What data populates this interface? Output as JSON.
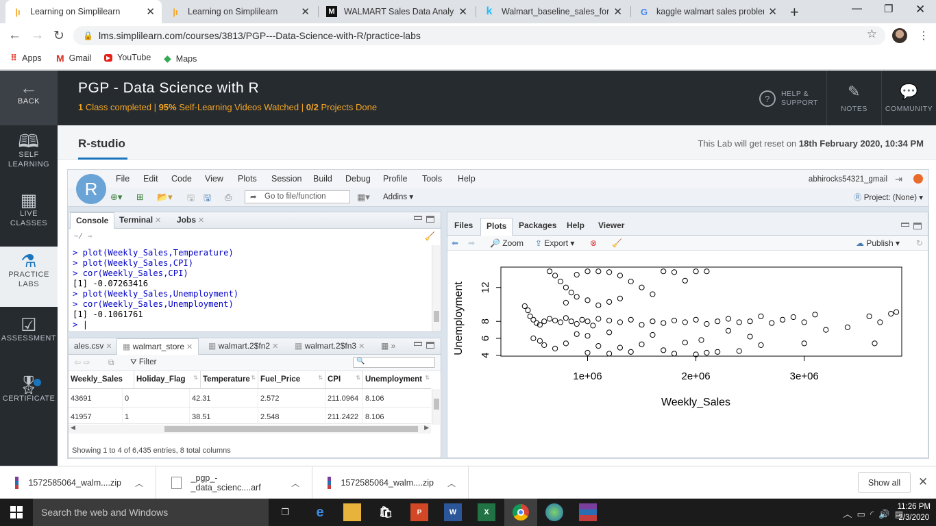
{
  "browser": {
    "tabs": [
      {
        "title": "Learning on Simplilearn",
        "active": true
      },
      {
        "title": "Learning on Simplilearn"
      },
      {
        "title": "WALMART Sales Data Analysis"
      },
      {
        "title": "Walmart_baseline_sales_foreca"
      },
      {
        "title": "kaggle walmart sales problem"
      }
    ],
    "url": "lms.simplilearn.com/courses/3813/PGP---Data-Science-with-R/practice-labs",
    "bookmarks": [
      "Apps",
      "Gmail",
      "YouTube",
      "Maps"
    ]
  },
  "rail": {
    "back": "BACK",
    "self_learning": [
      "SELF",
      "LEARNING"
    ],
    "live_classes": [
      "LIVE",
      "CLASSES"
    ],
    "practice_labs": [
      "PRACTICE",
      "LABS"
    ],
    "assessment": "ASSESSMENT",
    "certificate": "CERTIFICATE"
  },
  "header": {
    "course_title": "PGP - Data Science with R",
    "classes_completed": "1",
    "classes_label": "Class completed |",
    "videos_pct": "95%",
    "videos_label": "Self-Learning Videos Watched  |",
    "projects": "0/2",
    "projects_label": "Projects Done",
    "help": [
      "HELP &",
      "SUPPORT"
    ],
    "notes": "NOTES",
    "community": "COMMUNITY"
  },
  "lab": {
    "title": "R-studio",
    "reset_prefix": "This Lab will get reset on",
    "reset_date": "18th February 2020, 10:34 PM"
  },
  "rstudio": {
    "menu": [
      "File",
      "Edit",
      "Code",
      "View",
      "Plots",
      "Session",
      "Build",
      "Debug",
      "Profile",
      "Tools",
      "Help"
    ],
    "user": "abhirocks54321_gmail",
    "goto_placeholder": "Go to file/function",
    "addins": "Addins",
    "project": "Project: (None)",
    "console_tabs": [
      "Console",
      "Terminal",
      "Jobs"
    ],
    "cwd": "~/",
    "console_lines": [
      {
        "type": "cmd",
        "text": "> plot(Weekly_Sales,Temperature)"
      },
      {
        "type": "cmd",
        "text": "> plot(Weekly_Sales,CPI)"
      },
      {
        "type": "cmd",
        "text": "> cor(Weekly_Sales,CPI)"
      },
      {
        "type": "out",
        "text": "[1] -0.07263416"
      },
      {
        "type": "cmd",
        "text": "> plot(Weekly_Sales,Unemployment)"
      },
      {
        "type": "cmd",
        "text": "> cor(Weekly_Sales,Unemployment)"
      },
      {
        "type": "out",
        "text": "[1] -0.1061761"
      },
      {
        "type": "cmd",
        "text": "> "
      }
    ],
    "data_tabs": [
      "ales.csv",
      "walmart_store",
      "walmart.2$fn2",
      "walmart.2$fn3"
    ],
    "filter_label": "Filter",
    "columns": [
      "Weekly_Sales",
      "Holiday_Flag",
      "Temperature",
      "Fuel_Price",
      "CPI",
      "Unemployment"
    ],
    "rows": [
      [
        "43691",
        "0",
        "42.31",
        "2.572",
        "211.0964",
        "8.106"
      ],
      [
        "41957",
        "1",
        "38.51",
        "2.548",
        "211.2422",
        "8.106"
      ]
    ],
    "data_footer": "Showing 1 to 4 of 6,435 entries, 8 total columns",
    "right_tabs": [
      "Files",
      "Plots",
      "Packages",
      "Help",
      "Viewer"
    ],
    "plot_toolbar": {
      "zoom": "Zoom",
      "export": "Export",
      "publish": "Publish"
    }
  },
  "chart_data": {
    "type": "scatter",
    "title": "",
    "xlabel": "Weekly_Sales",
    "ylabel": "Unemployment",
    "xlim": [
      200000,
      3900000
    ],
    "ylim": [
      3.9,
      14.4
    ],
    "xticks": [
      "1e+06",
      "2e+06",
      "3e+06"
    ],
    "xtick_values": [
      1000000,
      2000000,
      3000000
    ],
    "yticks": [
      "4",
      "6",
      "8",
      "12"
    ],
    "ytick_values": [
      4,
      6,
      8,
      12
    ],
    "marker": "open-circle",
    "grid": false,
    "points": [
      [
        420000,
        9.8
      ],
      [
        450000,
        9.3
      ],
      [
        470000,
        8.6
      ],
      [
        500000,
        8.2
      ],
      [
        530000,
        7.8
      ],
      [
        560000,
        7.6
      ],
      [
        600000,
        8.0
      ],
      [
        650000,
        8.3
      ],
      [
        700000,
        8.1
      ],
      [
        750000,
        7.9
      ],
      [
        800000,
        8.4
      ],
      [
        850000,
        8.0
      ],
      [
        900000,
        7.7
      ],
      [
        950000,
        8.2
      ],
      [
        1000000,
        8.0
      ],
      [
        1050000,
        7.5
      ],
      [
        1100000,
        8.3
      ],
      [
        1200000,
        8.1
      ],
      [
        1300000,
        7.9
      ],
      [
        1400000,
        8.2
      ],
      [
        1500000,
        7.6
      ],
      [
        1600000,
        8.0
      ],
      [
        1700000,
        7.8
      ],
      [
        1800000,
        8.1
      ],
      [
        1900000,
        7.9
      ],
      [
        2000000,
        8.2
      ],
      [
        2100000,
        7.7
      ],
      [
        2200000,
        8.0
      ],
      [
        2300000,
        8.3
      ],
      [
        2400000,
        7.9
      ],
      [
        2500000,
        8.0
      ],
      [
        2600000,
        8.6
      ],
      [
        2700000,
        7.8
      ],
      [
        2800000,
        8.2
      ],
      [
        2900000,
        8.5
      ],
      [
        3000000,
        7.9
      ],
      [
        3100000,
        8.8
      ],
      [
        3200000,
        7.0
      ],
      [
        3400000,
        7.3
      ],
      [
        3600000,
        8.6
      ],
      [
        3700000,
        7.9
      ],
      [
        3800000,
        8.9
      ],
      [
        3850000,
        9.1
      ],
      [
        3650000,
        5.4
      ],
      [
        3000000,
        5.4
      ],
      [
        2600000,
        5.2
      ],
      [
        2400000,
        4.5
      ],
      [
        2200000,
        4.4
      ],
      [
        650000,
        13.9
      ],
      [
        700000,
        13.4
      ],
      [
        750000,
        12.7
      ],
      [
        800000,
        12.0
      ],
      [
        850000,
        11.4
      ],
      [
        900000,
        13.5
      ],
      [
        1000000,
        13.9
      ],
      [
        1100000,
        13.9
      ],
      [
        1200000,
        13.8
      ],
      [
        1300000,
        13.4
      ],
      [
        1400000,
        12.7
      ],
      [
        1500000,
        12.0
      ],
      [
        1600000,
        11.2
      ],
      [
        1700000,
        13.9
      ],
      [
        1800000,
        13.8
      ],
      [
        1900000,
        12.8
      ],
      [
        2000000,
        13.9
      ],
      [
        2100000,
        13.9
      ],
      [
        1000000,
        10.5
      ],
      [
        1100000,
        9.9
      ],
      [
        1200000,
        10.3
      ],
      [
        1300000,
        10.7
      ],
      [
        900000,
        10.9
      ],
      [
        800000,
        10.2
      ],
      [
        500000,
        6.0
      ],
      [
        560000,
        5.7
      ],
      [
        600000,
        5.2
      ],
      [
        700000,
        4.8
      ],
      [
        800000,
        5.4
      ],
      [
        900000,
        6.5
      ],
      [
        1000000,
        6.3
      ],
      [
        1100000,
        5.1
      ],
      [
        1300000,
        4.9
      ],
      [
        1500000,
        5.3
      ],
      [
        1700000,
        4.6
      ],
      [
        1900000,
        5.5
      ],
      [
        2100000,
        4.3
      ],
      [
        2050000,
        5.8
      ],
      [
        1600000,
        6.4
      ],
      [
        1200000,
        6.7
      ],
      [
        2300000,
        6.9
      ],
      [
        2500000,
        6.2
      ],
      [
        1000000,
        4.3
      ],
      [
        1200000,
        4.2
      ],
      [
        1400000,
        4.4
      ],
      [
        1800000,
        4.2
      ],
      [
        2000000,
        4.1
      ]
    ]
  }
}
